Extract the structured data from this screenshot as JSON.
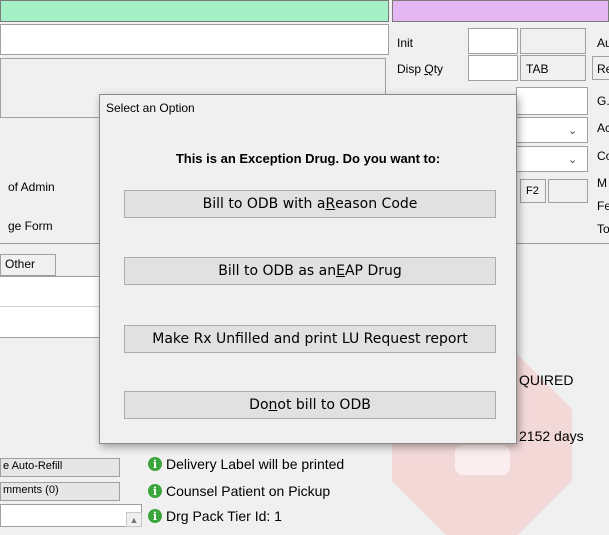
{
  "right_fields": {
    "init_label": "Init",
    "disp_qty_label_pre": "Disp ",
    "disp_qty_label_ul": "Q",
    "disp_qty_label_post": "ty",
    "unit_value": "TAB",
    "f2_label": "F2"
  },
  "far_right_labels": [
    "Au",
    "Re",
    "G.",
    "Ac",
    "Co",
    "M",
    "Fe",
    "To"
  ],
  "left_labels": {
    "route_of_admin": "of Admin",
    "dosage_form": "ge Form",
    "tab_other": "Other"
  },
  "background_text": {
    "required": "QUIRED",
    "days": "2152 days"
  },
  "bottom_buttons": {
    "auto_refill": "e Auto-Refill",
    "comments": "mments (0)"
  },
  "status_messages": [
    "Delivery Label will be printed",
    "Counsel Patient on Pickup",
    "Drg Pack Tier Id: 1"
  ],
  "dialog": {
    "title": "Select an Option",
    "heading": "This is an Exception Drug.  Do you want to:",
    "buttons": [
      {
        "pre": "Bill to ODB with a ",
        "ul": "R",
        "post": "eason Code"
      },
      {
        "pre": "Bill to ODB as an ",
        "ul": "E",
        "post": "AP Drug"
      },
      {
        "pre": "Make Rx Unfilled and print LU Request report",
        "ul": "",
        "post": ""
      },
      {
        "pre": "Do ",
        "ul": "n",
        "post": "ot bill to ODB"
      }
    ]
  },
  "colors": {
    "green_panel": "#a6f0c8",
    "pink_panel": "#e4b6f2",
    "info_icon": "#3aa53a"
  }
}
